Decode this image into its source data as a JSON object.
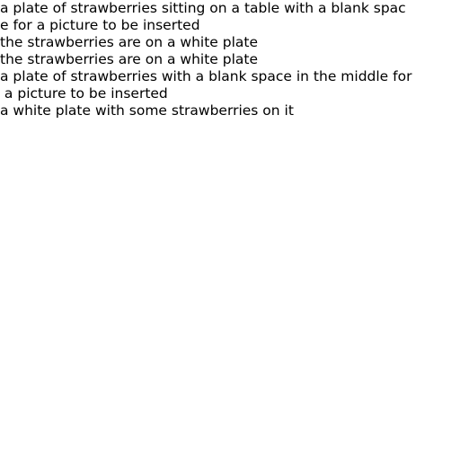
{
  "captions": [
    "a plate of strawberries sitting on a table with a blank spac",
    "e for a picture to be inserted",
    "the strawberries are on a white plate",
    "the strawberries are on a white plate",
    "a plate of strawberries with a blank space in the middle for",
    " a picture to be inserted",
    "a white plate with some strawberries on it"
  ]
}
